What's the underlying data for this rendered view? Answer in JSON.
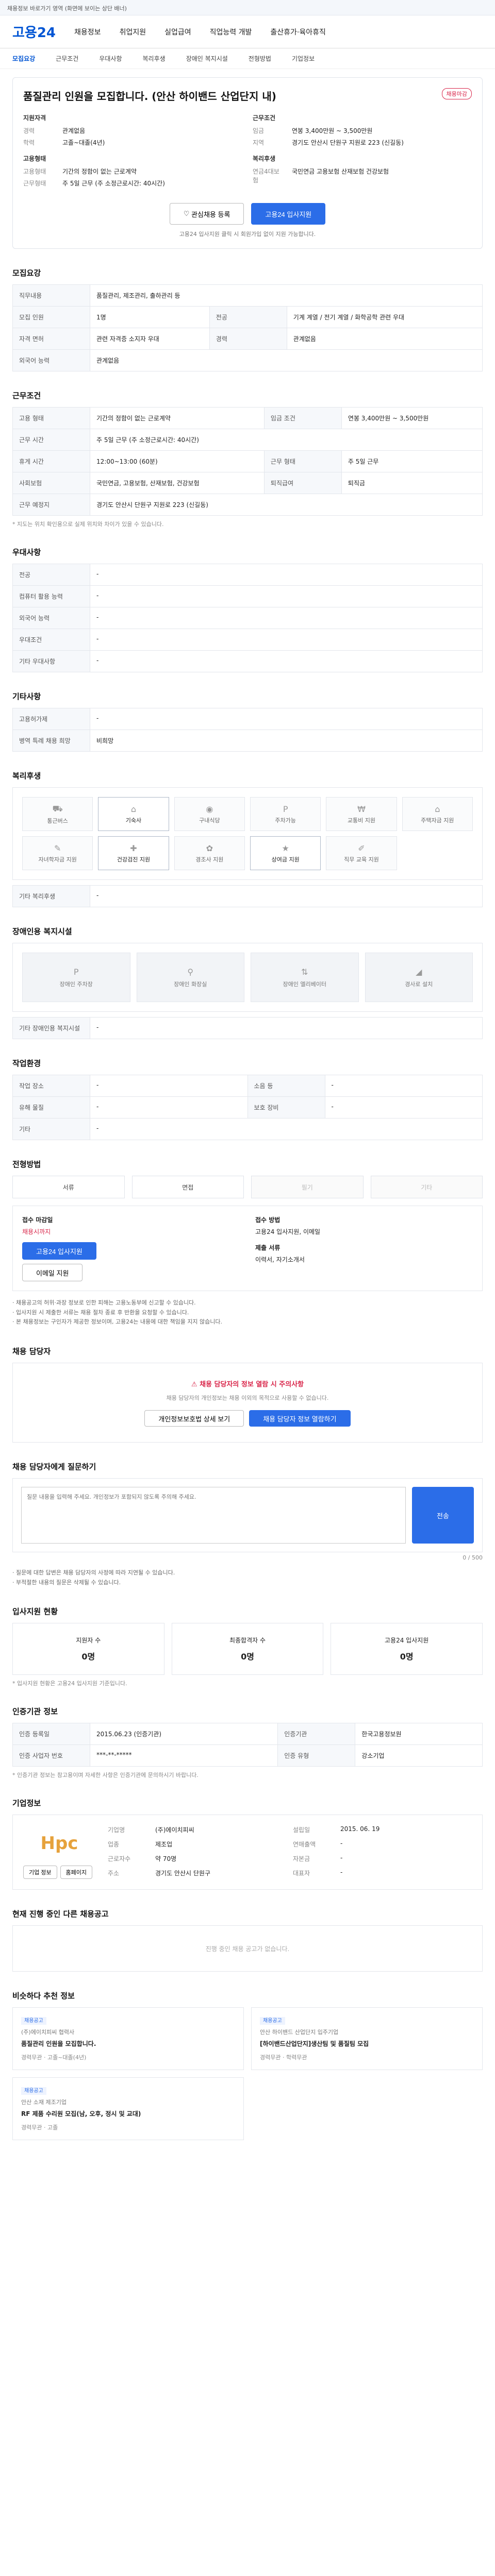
{
  "topbar": {
    "text": "채용정보 바로가기 영역 (화면에 보이는 상단 배너)"
  },
  "gnb": {
    "logo": "고용24",
    "menu": [
      "채용정보",
      "취업지원",
      "실업급여",
      "직업능력 개발",
      "출산휴가·육아휴직"
    ]
  },
  "subnav": {
    "items": [
      "모집요강",
      "근무조건",
      "우대사항",
      "복리후생",
      "장애인 복지시설",
      "전형방법",
      "기업정보"
    ]
  },
  "job": {
    "title": "품질관리 인원을 모집합니다. (안산 하이밴드 산업단지 내)",
    "badge": "채용마감",
    "left_head": "지원자격",
    "right_head": "근무조건",
    "left": [
      {
        "k": "경력",
        "v": "관계없음"
      },
      {
        "k": "학력",
        "v": "고졸~대졸(4년)"
      }
    ],
    "right": [
      {
        "k": "임금",
        "v": "연봉 3,400만원 ~ 3,500만원"
      },
      {
        "k": "지역",
        "v": "경기도 안산시 단원구 지원로 223 (신길동)"
      }
    ],
    "left2_head": "고용형태",
    "left2": [
      {
        "k": "고용형태",
        "v": "기간의 정함이 없는 근로계약"
      },
      {
        "k": "근무형태",
        "v": "주 5일 근무 (주 소정근로시간: 40시간)"
      }
    ],
    "right2_head": "복리후생",
    "right2": [
      {
        "k": "연금4대보험",
        "v": "국민연금 고용보험 산재보험 건강보험"
      }
    ],
    "scrap_btn": "관심채용 등록",
    "apply_btn": "고용24 입사지원",
    "note": "고용24 입사지원 클릭 시 회원가입 없이 지원 가능합니다."
  },
  "sections": {
    "recruit": "모집요강",
    "condition": "근무조건",
    "prefer": "우대사항",
    "welfare": "복리후생",
    "other": "기타사항",
    "disabled": "장애인용 복지시설",
    "env": "작업환경",
    "method": "전형방법",
    "manager": "채용 담당자",
    "qna": "채용 담당자에게 질문하기",
    "status": "입사지원 현황",
    "cert": "인증기관 정보",
    "company": "기업정보",
    "others": "현재 진행 중인 다른 채용공고",
    "recommend": "비슷하다 추천 정보"
  },
  "recruit_table": [
    {
      "h": "직무내용",
      "v": "품질관리, 제조관리, 출하관리 등"
    },
    {
      "h": "모집 인원",
      "v": "1명"
    },
    {
      "h": "전공",
      "v": "기계 계열 / 전기 계열 / 화학공학 관련 우대"
    },
    {
      "h": "자격 면허",
      "v": "관련 자격증 소지자 우대"
    },
    {
      "h": "경력",
      "v": "관계없음"
    },
    {
      "h": "외국어 능력",
      "v": "관계없음"
    }
  ],
  "condition_table": [
    {
      "h": "고용 형태",
      "v": "기간의 정함이 없는 근로계약"
    },
    {
      "h": "임금 조건",
      "v": "연봉 3,400만원 ~ 3,500만원"
    },
    {
      "h": "근무 시간",
      "v": "주 5일 근무 (주 소정근로시간: 40시간)"
    },
    {
      "h": "휴게 시간",
      "v": "12:00~13:00 (60분)"
    },
    {
      "h": "근무 형태",
      "v": "주 5일 근무"
    },
    {
      "h": "사회보험",
      "v": "국민연금, 고용보험, 산재보험, 건강보험"
    },
    {
      "h": "퇴직급여",
      "v": "퇴직금"
    },
    {
      "h": "근무 예정지",
      "v": "경기도 안산시 단원구 지원로 223 (신길동)"
    }
  ],
  "condition_note": "* 지도는 위치 확인용으로 실제 위치와 차이가 있을 수 있습니다.",
  "prefer_table": [
    {
      "h": "전공",
      "v": "-"
    },
    {
      "h": "컴퓨터 활용 능력",
      "v": "-"
    },
    {
      "h": "외국어 능력",
      "v": "-"
    },
    {
      "h": "우대조건",
      "v": "-"
    },
    {
      "h": "기타 우대사항",
      "v": "-"
    }
  ],
  "other_table": [
    {
      "h": "고용허가제",
      "v": "-"
    },
    {
      "h": "병역 특례 채용 희망",
      "v": "비희망"
    }
  ],
  "welfare_tiles": [
    {
      "icon": "car-icon",
      "label": "통근버스"
    },
    {
      "icon": "dorm-icon",
      "label": "기숙사"
    },
    {
      "icon": "meal-icon",
      "label": "구내식당"
    },
    {
      "icon": "parking-icon",
      "label": "주차가능"
    },
    {
      "icon": "fee-icon",
      "label": "교통비 지원"
    },
    {
      "icon": "house-icon",
      "label": "주택자금 지원"
    },
    {
      "icon": "school-icon",
      "label": "자녀학자금 지원"
    },
    {
      "icon": "health-icon",
      "label": "건강검진 지원"
    },
    {
      "icon": "gift-icon",
      "label": "경조사 지원"
    },
    {
      "icon": "bonus-icon",
      "label": "상여금 지원"
    },
    {
      "icon": "edu-icon",
      "label": "직무 교육 지원"
    }
  ],
  "welfare_extra": {
    "h": "기타 복리후생",
    "v": "-"
  },
  "disabled_tiles": [
    "장애인 주차장",
    "장애인 화장실",
    "장애인 엘리베이터",
    "경사로 설치"
  ],
  "disabled_extra": {
    "h": "기타 장애인용 복지시설",
    "v": "-"
  },
  "env_table": [
    {
      "h": "작업 장소",
      "v": "-"
    },
    {
      "h": "소음 등",
      "v": "-"
    },
    {
      "h": "유해 물질",
      "v": "-"
    },
    {
      "h": "보호 장비",
      "v": "-"
    },
    {
      "h": "기타",
      "v": "-"
    }
  ],
  "method": {
    "items": [
      {
        "label": "서류",
        "on": true
      },
      {
        "label": "면접",
        "on": true
      },
      {
        "label": "필기",
        "on": false
      },
      {
        "label": "기타",
        "on": false
      }
    ],
    "deadline_label": "접수 마감일",
    "deadline": "채용시까지",
    "apply_method_label": "접수 방법",
    "apply_method": "고용24 입사지원, 이메일",
    "doc_label": "제출 서류",
    "doc": "이력서, 자기소개서",
    "apply_btn": "고용24 입사지원",
    "email_btn": "이메일 지원"
  },
  "warnings": [
    "· 채용공고의 허위·과장 정보로 인한 피해는 고용노동부에 신고할 수 있습니다.",
    "· 입사지원 시 제출한 서류는 채용 절차 종료 후 반환을 요청할 수 있습니다.",
    "· 본 채용정보는 구인자가 제공한 정보이며, 고용24는 내용에 대한 책임을 지지 않습니다."
  ],
  "manager": {
    "title": "채용 담당자의 정보 열람 시 주의사항",
    "desc": "채용 담당자의 개인정보는 채용 이외의 목적으로 사용할 수 없습니다.",
    "btn1": "개인정보보호법 상세 보기",
    "btn2": "채용 담당자 정보 열람하기"
  },
  "qna": {
    "label": "채용 담당자에게 질문하기",
    "placeholder": "질문 내용을 입력해 주세요. 개인정보가 포함되지 않도록 주의해 주세요.",
    "counter": "0 / 500",
    "send": "전송",
    "notes": [
      "· 질문에 대한 답변은 채용 담당자의 사정에 따라 지연될 수 있습니다.",
      "· 부적절한 내용의 질문은 삭제될 수 있습니다."
    ]
  },
  "status": {
    "items": [
      {
        "label": "지원자 수",
        "value": "0명"
      },
      {
        "label": "최종합격자 수",
        "value": "0명"
      },
      {
        "label": "고용24 입사지원",
        "value": "0명"
      }
    ],
    "note": "* 입사지원 현황은 고용24 입사지원 기준입니다."
  },
  "cert": {
    "rows": [
      {
        "h": "인증 등록일",
        "v": "2015.06.23 (인증기관)",
        "h2": "인증기관",
        "v2": "한국고용정보원"
      },
      {
        "h": "인증 사업자 번호",
        "v": "***-**-*****",
        "h2": "인증 유형",
        "v2": "강소기업"
      }
    ],
    "note": "* 인증기관 정보는 참고용이며 자세한 사항은 인증기관에 문의하시기 바랍니다."
  },
  "company": {
    "logo": "Hpc",
    "name": "(주)에이치피씨",
    "rows": [
      {
        "k": "기업명",
        "v": "(주)에이치피씨",
        "k2": "설립일",
        "v2": "2015. 06. 19"
      },
      {
        "k": "업종",
        "v": "제조업",
        "k2": "연매출액",
        "v2": "-"
      },
      {
        "k": "근로자수",
        "v": "약 70명",
        "k2": "자본금",
        "v2": "-"
      },
      {
        "k": "주소",
        "v": "경기도 안산시 단원구",
        "k2": "대표자",
        "v2": "-"
      }
    ],
    "btn1": "기업 정보",
    "btn2": "홈페이지"
  },
  "others": {
    "empty": "진행 중인 채용 공고가 없습니다."
  },
  "recommend": [
    {
      "badge": "채용공고",
      "company": "(주)에이치피씨 협력사",
      "title": "품질관리 인원을 모집합니다.",
      "meta": "경력무관 · 고졸~대졸(4년)"
    },
    {
      "badge": "채용공고",
      "company": "안산 하이밴드 산업단지 입주기업",
      "title": "[하이밴드산업단지]생산팀 및 품질팀 모집",
      "meta": "경력무관 · 학력무관"
    },
    {
      "badge": "채용공고",
      "company": "안산 소재 제조기업",
      "title": "RF 제품 수리원 모집(남, 오후, 정시 및 교대)",
      "meta": "경력무관 · 고졸"
    }
  ],
  "colors": {
    "primary": "#2b6de8",
    "brand": "#0055d4",
    "danger": "#d9264a",
    "company_logo": "#e6a23c"
  }
}
